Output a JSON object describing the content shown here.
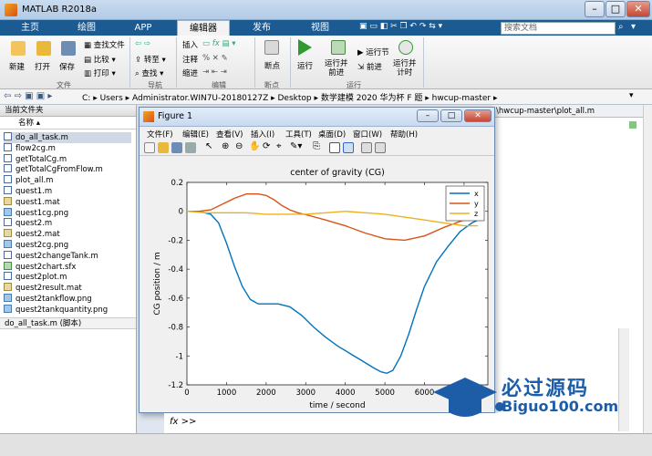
{
  "app": {
    "title": "MATLAB R2018a"
  },
  "ribbon_tabs": [
    "主页",
    "绘图",
    "APP",
    "编辑器",
    "发布",
    "视图"
  ],
  "search": {
    "placeholder": "搜索文档"
  },
  "ribbon": {
    "file_group": {
      "new": "新建",
      "open": "打开",
      "save": "保存",
      "find_files": "查找文件",
      "compare": "比较",
      "print": "打印",
      "label": "文件"
    },
    "nav_group": {
      "goto": "转至",
      "find": "查找",
      "label": "导航"
    },
    "edit_group": {
      "insert": "插入",
      "comment": "注释",
      "indent": "缩进",
      "fx": "fx",
      "label": "编辑"
    },
    "bp_group": {
      "breakpoints": "断点",
      "label": "断点"
    },
    "run_group": {
      "run": "运行",
      "run_advance": "运行并\n前进",
      "run_section": "运行节",
      "advance": "前进",
      "run_time": "运行并\n计时",
      "label": "运行"
    }
  },
  "address": {
    "path_segments": [
      "C:",
      "Users",
      "Administrator.WIN7U-20180127Z",
      "Desktop",
      "数学建模 2020 华为杯 F 题",
      "hwcup-master"
    ]
  },
  "left_panel": {
    "header": "当前文件夹",
    "column": "名称",
    "files": [
      {
        "name": "do_all_task.m",
        "type": "m",
        "selected": true
      },
      {
        "name": "flow2cg.m",
        "type": "m"
      },
      {
        "name": "getTotalCg.m",
        "type": "m"
      },
      {
        "name": "getTotalCgFromFlow.m",
        "type": "m"
      },
      {
        "name": "plot_all.m",
        "type": "m"
      },
      {
        "name": "quest1.m",
        "type": "m"
      },
      {
        "name": "quest1.mat",
        "type": "mat"
      },
      {
        "name": "quest1cg.png",
        "type": "png"
      },
      {
        "name": "quest2.m",
        "type": "m"
      },
      {
        "name": "quest2.mat",
        "type": "mat"
      },
      {
        "name": "quest2cg.png",
        "type": "png"
      },
      {
        "name": "quest2changeTank.m",
        "type": "m"
      },
      {
        "name": "quest2chart.sfx",
        "type": "sfx"
      },
      {
        "name": "quest2plot.m",
        "type": "m"
      },
      {
        "name": "quest2result.mat",
        "type": "mat"
      },
      {
        "name": "quest2tankflow.png",
        "type": "png"
      },
      {
        "name": "quest2tankquantity.png",
        "type": "png"
      }
    ],
    "details": "do_all_task.m  (脚本)"
  },
  "editor": {
    "tab_title": "\\hwcup-master\\plot_all.m"
  },
  "figure": {
    "title": "Figure 1",
    "menu": [
      "文件(F)",
      "编辑(E)",
      "查看(V)",
      "插入(I)",
      "工具(T)",
      "桌面(D)",
      "窗口(W)",
      "帮助(H)"
    ]
  },
  "chart_data": {
    "type": "line",
    "title": "center of gravity (CG)",
    "xlabel": "time / second",
    "ylabel": "CG position / m",
    "xlim": [
      0,
      7600
    ],
    "ylim": [
      -1.2,
      0.2
    ],
    "xticks": [
      0,
      1000,
      2000,
      3000,
      4000,
      5000,
      6000,
      7000
    ],
    "yticks": [
      -1.2,
      -1,
      -0.8,
      -0.6,
      -0.4,
      -0.2,
      0,
      0.2
    ],
    "ytick_labels": [
      "-1.2",
      "-1",
      "-0.8",
      "-0.6",
      "-0.4",
      "-0.2",
      "0",
      "0.2"
    ],
    "legend_position": "top-right",
    "series": [
      {
        "name": "x",
        "color": "#0072bd",
        "x": [
          0,
          300,
          600,
          800,
          1000,
          1200,
          1400,
          1600,
          1800,
          2000,
          2300,
          2600,
          2900,
          3200,
          3500,
          3800,
          4100,
          4400,
          4700,
          4900,
          5050,
          5200,
          5400,
          5600,
          5800,
          6000,
          6300,
          6600,
          6900,
          7200,
          7350
        ],
        "y": [
          0,
          0,
          -0.02,
          -0.08,
          -0.22,
          -0.38,
          -0.52,
          -0.61,
          -0.64,
          -0.64,
          -0.64,
          -0.66,
          -0.72,
          -0.8,
          -0.87,
          -0.93,
          -0.98,
          -1.03,
          -1.08,
          -1.11,
          -1.12,
          -1.1,
          -1.0,
          -0.85,
          -0.68,
          -0.52,
          -0.35,
          -0.24,
          -0.14,
          -0.08,
          -0.06
        ]
      },
      {
        "name": "y",
        "color": "#d95319",
        "x": [
          0,
          300,
          600,
          900,
          1200,
          1500,
          1800,
          2000,
          2200,
          2400,
          2600,
          2800,
          3100,
          3500,
          4000,
          4500,
          5000,
          5500,
          6000,
          6500,
          7000,
          7350
        ],
        "y": [
          0,
          0,
          0.01,
          0.05,
          0.09,
          0.12,
          0.12,
          0.11,
          0.08,
          0.04,
          0.01,
          -0.01,
          -0.03,
          -0.06,
          -0.1,
          -0.15,
          -0.19,
          -0.2,
          -0.17,
          -0.11,
          -0.06,
          -0.05
        ]
      },
      {
        "name": "z",
        "color": "#edb120",
        "x": [
          0,
          500,
          1000,
          1500,
          2000,
          2500,
          3000,
          3500,
          4000,
          4500,
          5000,
          5500,
          6000,
          6500,
          7000,
          7350
        ],
        "y": [
          0,
          -0.01,
          -0.01,
          -0.01,
          -0.02,
          -0.02,
          -0.02,
          -0.01,
          0,
          -0.01,
          -0.02,
          -0.04,
          -0.06,
          -0.08,
          -0.1,
          -0.1
        ]
      }
    ]
  },
  "command": {
    "prompt": "fx >>"
  },
  "watermark": {
    "brand": "必过源码",
    "url": "Biguo100.com"
  }
}
